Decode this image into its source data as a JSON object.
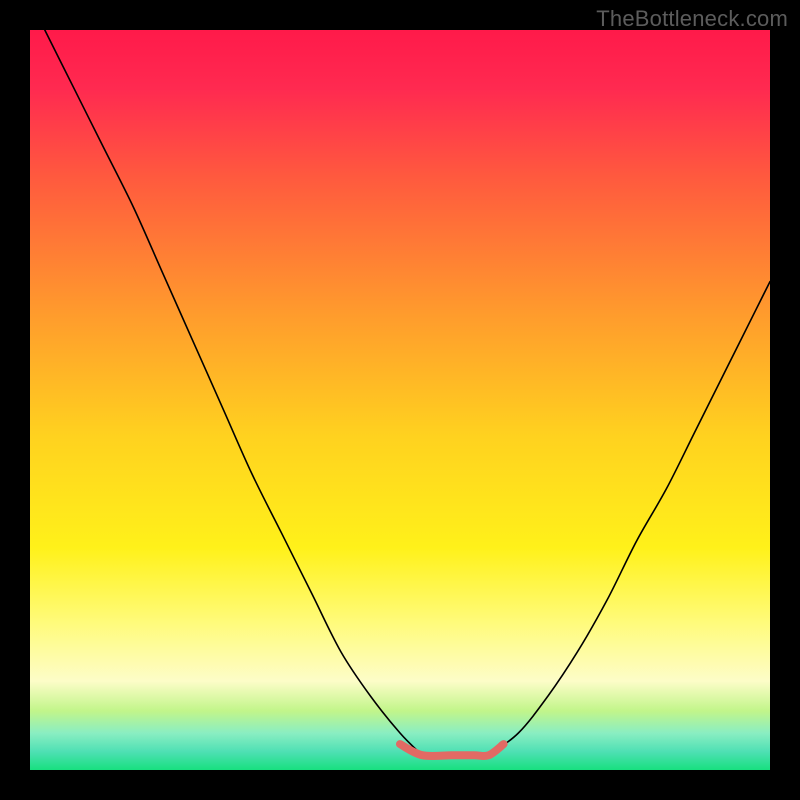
{
  "watermark": "TheBottleneck.com",
  "chart_data": {
    "type": "line",
    "title": "",
    "xlabel": "",
    "ylabel": "",
    "xlim": [
      0,
      100
    ],
    "ylim": [
      0,
      100
    ],
    "grid": false,
    "gradient_stops": [
      {
        "offset": 0.0,
        "color": "#ff1a4a"
      },
      {
        "offset": 0.08,
        "color": "#ff2a50"
      },
      {
        "offset": 0.2,
        "color": "#ff5a3e"
      },
      {
        "offset": 0.38,
        "color": "#ff9a2d"
      },
      {
        "offset": 0.55,
        "color": "#ffd21f"
      },
      {
        "offset": 0.7,
        "color": "#fff11a"
      },
      {
        "offset": 0.8,
        "color": "#fffb7a"
      },
      {
        "offset": 0.88,
        "color": "#fdfdc8"
      },
      {
        "offset": 0.92,
        "color": "#c2f58a"
      },
      {
        "offset": 0.95,
        "color": "#8aeec2"
      },
      {
        "offset": 0.975,
        "color": "#4fe0b4"
      },
      {
        "offset": 1.0,
        "color": "#17e07f"
      }
    ],
    "series": [
      {
        "name": "bottleneck-curve-left",
        "type": "line",
        "x": [
          2,
          6,
          10,
          14,
          18,
          22,
          26,
          30,
          34,
          38,
          42,
          46,
          50,
          53
        ],
        "y": [
          100,
          92,
          84,
          76,
          67,
          58,
          49,
          40,
          32,
          24,
          16,
          10,
          5,
          2
        ]
      },
      {
        "name": "bottleneck-curve-right",
        "type": "line",
        "x": [
          62,
          66,
          70,
          74,
          78,
          82,
          86,
          90,
          94,
          98,
          100
        ],
        "y": [
          2,
          5,
          10,
          16,
          23,
          31,
          38,
          46,
          54,
          62,
          66
        ]
      },
      {
        "name": "optimal-flat-zone",
        "type": "line",
        "x": [
          50,
          53,
          57,
          60,
          62,
          64
        ],
        "y": [
          3.5,
          2,
          2,
          2,
          2,
          3.5
        ]
      }
    ],
    "highlight": {
      "name": "optimal-flat-zone",
      "color": "#e26a64",
      "stroke_width": 8
    }
  }
}
